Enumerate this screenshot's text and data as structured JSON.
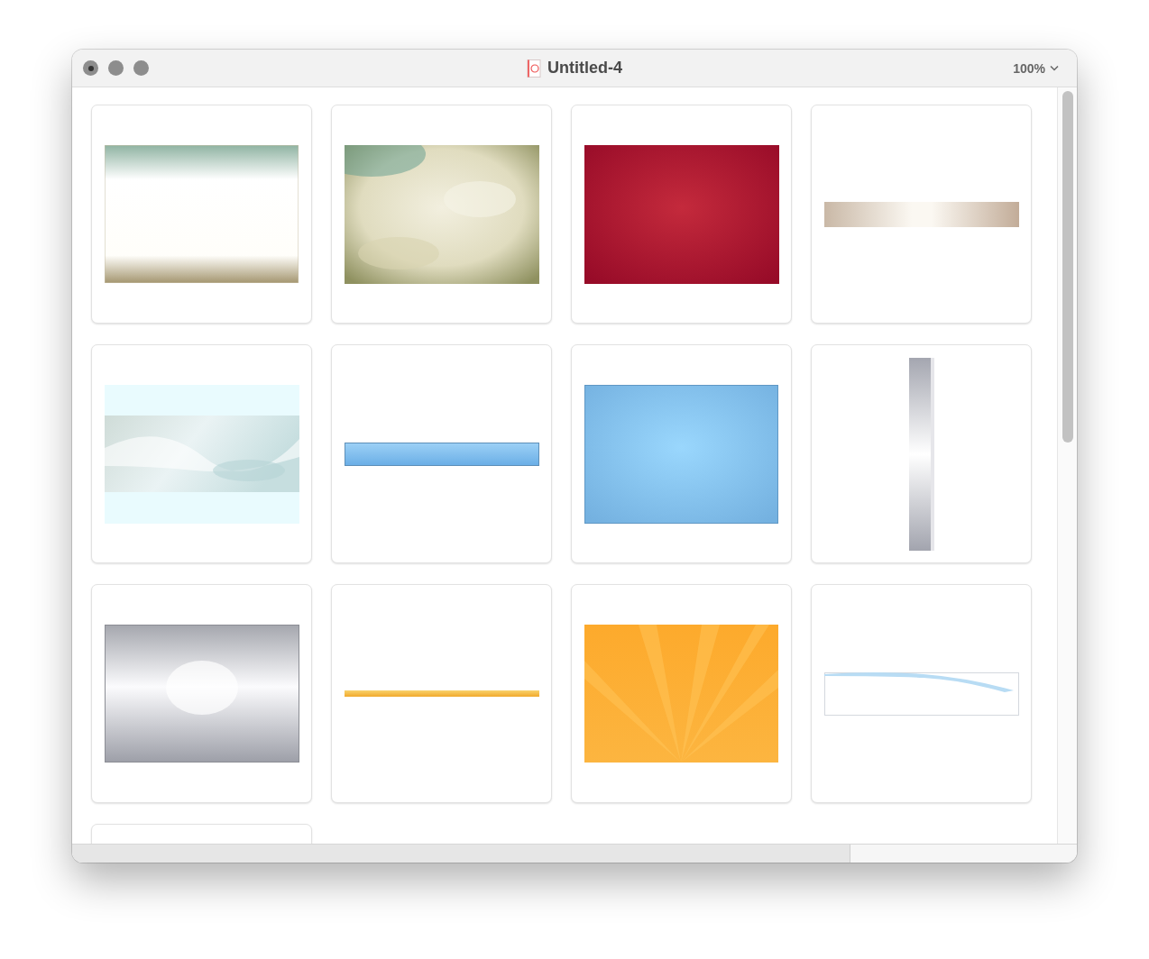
{
  "window": {
    "title": "Untitled-4",
    "zoom": "100%"
  },
  "thumbnails": [
    {
      "kind": "picture"
    },
    {
      "kind": "picture"
    },
    {
      "kind": "picture"
    },
    {
      "kind": "picture"
    },
    {
      "kind": "picture"
    },
    {
      "kind": "picture"
    },
    {
      "kind": "picture"
    },
    {
      "kind": "picture"
    },
    {
      "kind": "picture"
    },
    {
      "kind": "picture"
    },
    {
      "kind": "picture"
    },
    {
      "kind": "picture"
    },
    {
      "kind": "blank"
    }
  ]
}
